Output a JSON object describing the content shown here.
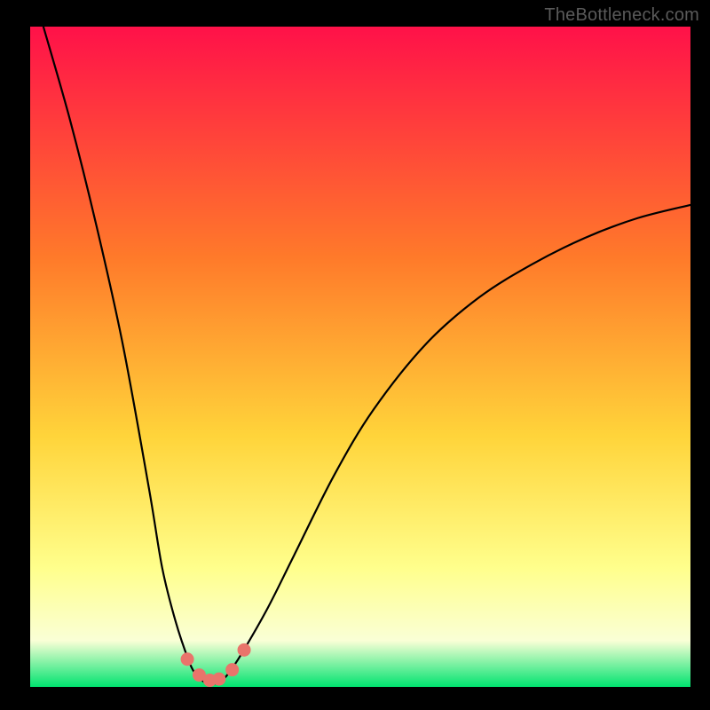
{
  "watermark": "TheBottleneck.com",
  "colors": {
    "bg": "#000000",
    "gradient_top": "#ff1149",
    "gradient_mid_upper": "#ff7a2a",
    "gradient_mid": "#ffd43a",
    "gradient_low": "#ffff8c",
    "gradient_pale": "#faffd6",
    "gradient_bottom": "#00e36f",
    "curve": "#000000",
    "marker_fill": "#e9746b",
    "marker_stroke": "#e9746b"
  },
  "chart_data": {
    "type": "line",
    "title": "",
    "xlabel": "",
    "ylabel": "",
    "xlim": [
      0,
      100
    ],
    "ylim": [
      0,
      100
    ],
    "series": [
      {
        "name": "bottleneck-curve",
        "x": [
          2,
          6,
          10,
          14,
          18,
          20,
          22,
          24,
          25,
          26,
          27,
          28,
          29,
          30,
          32,
          36,
          40,
          46,
          52,
          60,
          68,
          76,
          84,
          92,
          100
        ],
        "y": [
          100,
          86,
          70,
          52,
          30,
          18,
          10,
          4,
          2,
          1,
          0.5,
          0.5,
          1,
          2,
          5,
          12,
          20,
          32,
          42,
          52,
          59,
          64,
          68,
          71,
          73
        ]
      }
    ],
    "markers": {
      "name": "highlight-dots",
      "x": [
        23.8,
        25.6,
        27.2,
        28.6,
        30.6,
        32.4
      ],
      "y": [
        4.2,
        1.8,
        1.0,
        1.2,
        2.6,
        5.6
      ]
    }
  }
}
